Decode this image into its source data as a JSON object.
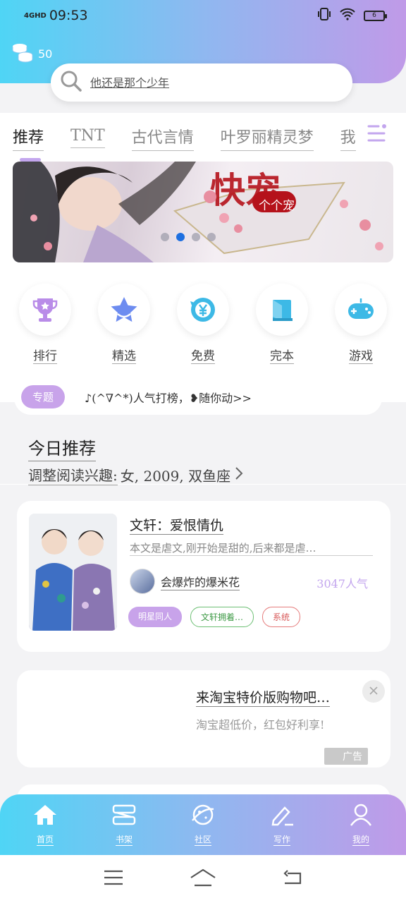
{
  "status_bar": {
    "network": "4GHD",
    "time": "09:53",
    "battery": "6"
  },
  "header": {
    "coins": "50"
  },
  "search": {
    "placeholder": "他还是那个少年"
  },
  "tabs": [
    {
      "label": "推荐",
      "active": true
    },
    {
      "label": "TNT",
      "active": false
    },
    {
      "label": "古代言情",
      "active": false
    },
    {
      "label": "叶罗丽精灵梦",
      "active": false
    },
    {
      "label": "我",
      "active": false
    }
  ],
  "banner": {
    "title_text": "个个宠",
    "dots": 4,
    "active_dot": 1
  },
  "quick_links": [
    {
      "label": "排行",
      "icon": "trophy-icon"
    },
    {
      "label": "精选",
      "icon": "star-icon"
    },
    {
      "label": "免费",
      "icon": "yen-icon"
    },
    {
      "label": "完本",
      "icon": "book-icon"
    },
    {
      "label": "游戏",
      "icon": "gamepad-icon"
    }
  ],
  "topic": {
    "tag": "专题",
    "text": "♪(^∇^*)人气打榜，❥随你动>>"
  },
  "recommend": {
    "title": "今日推荐",
    "sub_prefix": "调整阅读兴趣:",
    "sub_values": "女, 2009, 双鱼座"
  },
  "book": {
    "title": "文轩：爱恨情仇",
    "desc": "本文是虐文,刚开始是甜的,后来都是虐…",
    "author": "会爆炸的爆米花",
    "popularity": "3047人气",
    "tags": [
      "明星同人",
      "文轩拥着…",
      "系统"
    ]
  },
  "ad": {
    "title": "来淘宝特价版购物吧…",
    "subtitle": "淘宝超低价，红包好利享!",
    "label": "广告"
  },
  "bottom_nav": [
    {
      "label": "首页",
      "icon": "home-icon"
    },
    {
      "label": "书架",
      "icon": "bookshelf-icon"
    },
    {
      "label": "社区",
      "icon": "planet-icon"
    },
    {
      "label": "写作",
      "icon": "pen-icon"
    },
    {
      "label": "我的",
      "icon": "user-icon"
    }
  ],
  "colors": {
    "gradient_start": "#4fd5f5",
    "gradient_end": "#c09ae8",
    "accent_purple": "#c8a3ea",
    "active_dot": "#1e6fe0"
  }
}
